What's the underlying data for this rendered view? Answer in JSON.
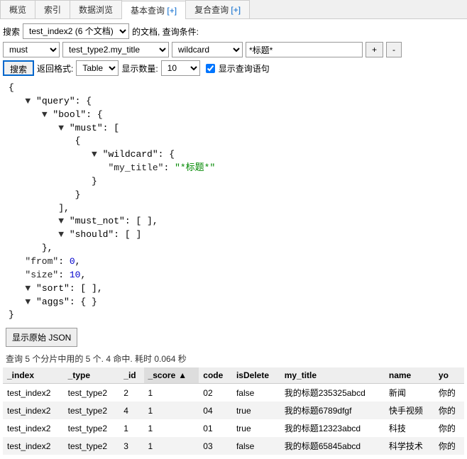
{
  "tabs": {
    "items": [
      {
        "label": "概览",
        "plus": ""
      },
      {
        "label": "索引",
        "plus": ""
      },
      {
        "label": "数据浏览",
        "plus": ""
      },
      {
        "label": "基本查询",
        "plus": " [+]"
      },
      {
        "label": "复合查询",
        "plus": " [+]"
      }
    ],
    "activeIndex": 3
  },
  "searchBar": {
    "prefix": "搜索",
    "indexSelect": "test_index2 (6 个文档)",
    "indexSuffix": "的文档, 查询条件:",
    "boolOp": "must",
    "field": "test_type2.my_title",
    "matchType": "wildcard",
    "value": "*标题*",
    "plus": "+",
    "minus": "-"
  },
  "controls": {
    "searchBtn": "搜索",
    "returnFormatLabel": "返回格式:",
    "returnFormat": "Table",
    "showCountLabel": "显示数量:",
    "showCount": "10",
    "showQueryLabel": "显示查询语句"
  },
  "query": {
    "lines": [
      {
        "indent": 0,
        "tri": false,
        "text": "{"
      },
      {
        "indent": 1,
        "tri": true,
        "text": "\"query\": {"
      },
      {
        "indent": 2,
        "tri": true,
        "text": "\"bool\": {"
      },
      {
        "indent": 3,
        "tri": true,
        "text": "\"must\": ["
      },
      {
        "indent": 4,
        "tri": false,
        "text": "{"
      },
      {
        "indent": 5,
        "tri": true,
        "text": "\"wildcard\": {"
      },
      {
        "indent": 6,
        "tri": false,
        "key": "\"my_title\"",
        "colon": ": ",
        "val": "\"*标题*\"",
        "cls": "str"
      },
      {
        "indent": 5,
        "tri": false,
        "text": "}"
      },
      {
        "indent": 4,
        "tri": false,
        "text": "}"
      },
      {
        "indent": 3,
        "tri": false,
        "text": "],"
      },
      {
        "indent": 3,
        "tri": true,
        "text": "\"must_not\": [ ],"
      },
      {
        "indent": 3,
        "tri": true,
        "text": "\"should\": [ ]"
      },
      {
        "indent": 2,
        "tri": false,
        "text": "},"
      },
      {
        "indent": 1,
        "tri": false,
        "key": "\"from\"",
        "colon": ": ",
        "val": "0",
        "cls": "num",
        "trail": ","
      },
      {
        "indent": 1,
        "tri": false,
        "key": "\"size\"",
        "colon": ": ",
        "val": "10",
        "cls": "num",
        "trail": ","
      },
      {
        "indent": 1,
        "tri": true,
        "text": "\"sort\": [ ],"
      },
      {
        "indent": 1,
        "tri": true,
        "text": "\"aggs\": { }"
      },
      {
        "indent": 0,
        "tri": false,
        "text": "}"
      }
    ],
    "rawBtn": "显示原始 JSON"
  },
  "statusLine": "查询 5 个分片中用的 5 个. 4 命中. 耗时 0.064 秒",
  "table": {
    "columns": [
      "_index",
      "_type",
      "_id",
      "_score",
      "code",
      "isDelete",
      "my_title",
      "name",
      "yo"
    ],
    "sortedCol": 3,
    "sortInd": "▲",
    "rows": [
      [
        "test_index2",
        "test_type2",
        "2",
        "1",
        "02",
        "false",
        "我的标题235325abcd",
        "新闻",
        "你的"
      ],
      [
        "test_index2",
        "test_type2",
        "4",
        "1",
        "04",
        "true",
        "我的标题6789dfgf",
        "快手视频",
        "你的"
      ],
      [
        "test_index2",
        "test_type2",
        "1",
        "1",
        "01",
        "true",
        "我的标题12323abcd",
        "科技",
        "你的"
      ],
      [
        "test_index2",
        "test_type2",
        "3",
        "1",
        "03",
        "false",
        "我的标题65845abcd",
        "科学技术",
        "你的"
      ]
    ]
  },
  "chart_data": {
    "type": "table",
    "columns": [
      "_index",
      "_type",
      "_id",
      "_score",
      "code",
      "isDelete",
      "my_title",
      "name"
    ],
    "rows": [
      [
        "test_index2",
        "test_type2",
        "2",
        1,
        "02",
        false,
        "我的标题235325abcd",
        "新闻"
      ],
      [
        "test_index2",
        "test_type2",
        "4",
        1,
        "04",
        true,
        "我的标题6789dfgf",
        "快手视频"
      ],
      [
        "test_index2",
        "test_type2",
        "1",
        1,
        "01",
        true,
        "我的标题12323abcd",
        "科技"
      ],
      [
        "test_index2",
        "test_type2",
        "3",
        1,
        "03",
        false,
        "我的标题65845abcd",
        "科学技术"
      ]
    ]
  }
}
